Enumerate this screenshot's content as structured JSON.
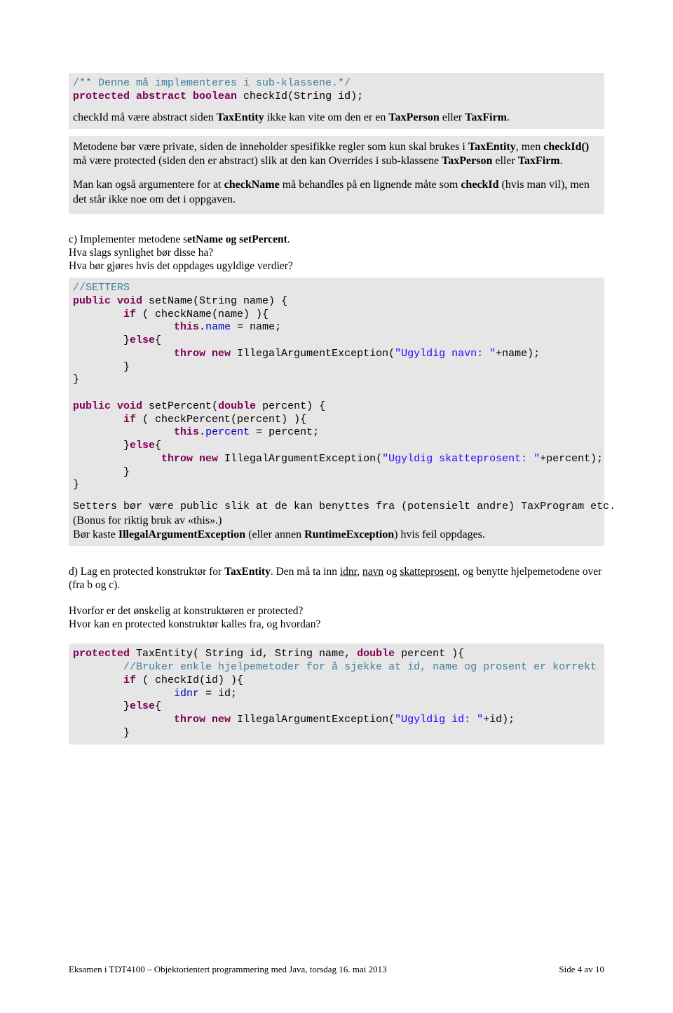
{
  "block1": {
    "line1_a": "/** Denne må implementeres i sub-klassene.*/",
    "line2_a": "protected abstract boolean",
    "line2_b": " checkId(String id);",
    "para1_a": "checkId må være abstract siden ",
    "para1_b": "TaxEntity",
    "para1_c": " ikke kan vite om den er en ",
    "para1_d": "TaxPerson",
    "para1_e": " eller ",
    "para1_f": "TaxFirm",
    "para1_g": "."
  },
  "answer1": {
    "p1_a": "Metodene bør være private, siden de inneholder spesifikke regler som kun skal brukes i ",
    "p1_b": "TaxEntity",
    "p1_c": ", men ",
    "p1_d": "checkId()",
    "p1_e": " må være protected (siden den er abstract) slik at den kan Overrides i sub-klassene ",
    "p1_f": "TaxPerson",
    "p1_g": " eller ",
    "p1_h": "TaxFirm",
    "p1_i": ".",
    "p2_a": "Man kan også argumentere for at ",
    "p2_b": "checkName",
    "p2_c": " må behandles på en lignende måte som ",
    "p2_d": "checkId",
    "p2_e": " (hvis man vil), men det står ikke noe om det i oppgaven."
  },
  "taskC": {
    "l1_a": "c) Implementer metodene s",
    "l1_b": "etName og setPercent",
    "l1_c": ".",
    "l2": "Hva slags synlighet bør disse ha?",
    "l3": "Hva bør gjøres hvis det oppdages ugyldige verdier?"
  },
  "code2": {
    "c0": "//SETTERS",
    "c1": "public void",
    "c1b": " setName(String name) {",
    "c2a": "        ",
    "c2b": "if",
    "c2c": " ( checkName(name) ){",
    "c3a": "                ",
    "c3b": "this",
    "c3c": ".",
    "c3d": "name",
    "c3e": " = name;",
    "c4a": "        }",
    "c4b": "else",
    "c4c": "{",
    "c5a": "                ",
    "c5b": "throw new",
    "c5c": " IllegalArgumentException(",
    "c5d": "\"Ugyldig navn: \"",
    "c5e": "+name);",
    "c6": "        }",
    "c7": "}",
    "d1": "public void",
    "d1b": " setPercent(",
    "d1c": "double",
    "d1d": " percent) {",
    "d2a": "        ",
    "d2b": "if",
    "d2c": " ( checkPercent(percent) ){",
    "d3a": "                ",
    "d3b": "this",
    "d3c": ".",
    "d3d": "percent",
    "d3e": " = percent;",
    "d4a": "        }",
    "d4b": "else",
    "d4c": "{",
    "d5a": "              ",
    "d5b": "throw new",
    "d5c": " IllegalArgumentException(",
    "d5d": "\"Ugyldig skatteprosent: \"",
    "d5e": "+percent);",
    "d6": "        }",
    "d7": "}",
    "t1": "Setters bør være public slik at de kan benyttes fra (potensielt andre) TaxProgram etc.",
    "t2": "(Bonus for riktig bruk av «this».)",
    "t3_a": "Bør kaste ",
    "t3_b": "IllegalArgumentException",
    "t3_c": " (eller annen ",
    "t3_d": "RuntimeException",
    "t3_e": ") hvis feil oppdages."
  },
  "taskD": {
    "l1_a": "d) Lag en protected konstruktør for ",
    "l1_b": "TaxEntity",
    "l1_c": ". Den må ta inn ",
    "l1_d": "idnr",
    "l1_e": ", ",
    "l1_f": "navn",
    "l1_g": " og ",
    "l1_h": "skatteprosent",
    "l1_i": ", og benytte hjelpemetodene over (fra b og c).",
    "l2": "Hvorfor er det ønskelig at konstruktøren er protected?",
    "l3": "Hvor kan en protected konstruktør kalles fra, og hvordan?"
  },
  "code3": {
    "a1a": "protected",
    "a1b": " TaxEntity( String id, String name, ",
    "a1c": "double",
    "a1d": " percent ){",
    "a2": "        //Bruker enkle hjelpemetoder for å sjekke at id, name og prosent er korrekt",
    "a3a": "        ",
    "a3b": "if",
    "a3c": " ( checkId(id) ){",
    "a4a": "                ",
    "a4b": "idnr",
    "a4c": " = id;",
    "a5a": "        }",
    "a5b": "else",
    "a5c": "{",
    "a6a": "                ",
    "a6b": "throw new",
    "a6c": " IllegalArgumentException(",
    "a6d": "\"Ugyldig id: \"",
    "a6e": "+id);",
    "a7": "        }"
  },
  "footer": {
    "left": "Eksamen i TDT4100 – Objektorientert programmering med Java, torsdag 16. mai 2013",
    "right": "Side 4 av 10"
  }
}
